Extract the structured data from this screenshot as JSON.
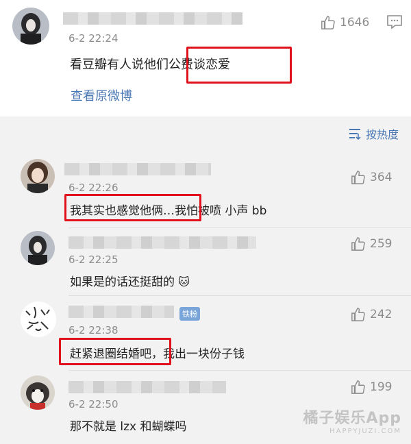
{
  "main_post": {
    "time": "6-2 22:24",
    "like_count": "1646",
    "text": "看豆瓣有人说他们公费谈恋爱",
    "view_original": "查看原微博"
  },
  "sort": {
    "label": "按热度"
  },
  "comments": [
    {
      "time": "6-2 22:26",
      "like_count": "364",
      "text": "我其实也感觉他俩…我怕被喷 小声 bb"
    },
    {
      "time": "6-2 22:25",
      "like_count": "259",
      "text": "如果是的话还挺甜的",
      "emoji": "🐱"
    },
    {
      "time": "6-2 22:38",
      "like_count": "242",
      "text": "赶紧退圈结婚吧，我出一块份子钱",
      "badge": "铁粉"
    },
    {
      "time": "6-2 22:50",
      "like_count": "199",
      "text": "那不就是 lzx 和蝴蝶吗"
    }
  ],
  "watermark": {
    "line1": "橘子娱乐App",
    "line2": "HAPPYJUZI.COM"
  },
  "colors": {
    "highlight_red": "#e0101c",
    "link_blue": "#4a78b5",
    "meta_gray": "#8c8c8c"
  }
}
